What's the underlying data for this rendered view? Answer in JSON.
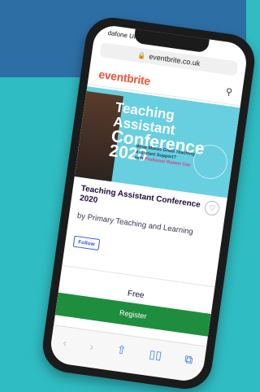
{
  "status": {
    "carrier": "dafone UK"
  },
  "browser": {
    "url": "eventbrite.co.uk"
  },
  "header": {
    "logo": "eventbrite",
    "search_icon": "search-icon"
  },
  "banner": {
    "title_line1": "Teaching Assistant",
    "title_line2": "Conference 2020",
    "sub_line1": "What Makes Great Teaching",
    "sub_line2": "Assistant Support?",
    "sub_with": "with",
    "sub_who": "Professor Robert Coe"
  },
  "event": {
    "title": "Teaching Assistant Conference 2020",
    "organizer": "by Primary Teaching and Learning",
    "follow_label": "Follow"
  },
  "purchase": {
    "price": "Free",
    "register_label": "Register"
  },
  "toolbar": {
    "icons": [
      "back-icon",
      "forward-icon",
      "share-icon",
      "bookmarks-icon",
      "tabs-icon"
    ]
  },
  "colors": {
    "brand": "#f05537",
    "register": "#1e8e3e",
    "banner": "#67cfe0",
    "background": "#2fbcc2"
  }
}
